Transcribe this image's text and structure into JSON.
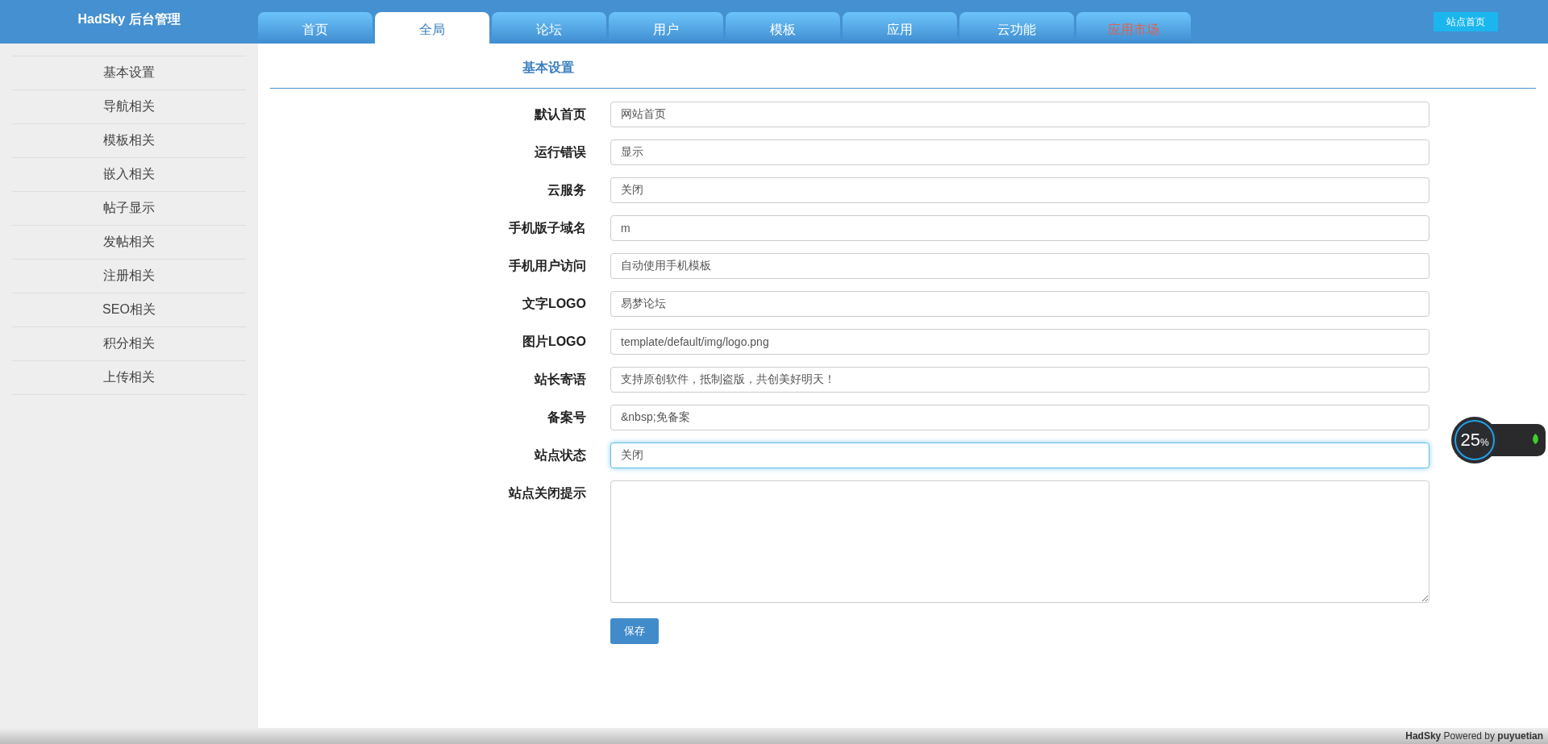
{
  "header": {
    "title": "HadSky 后台管理",
    "site_button": "站点首页"
  },
  "tabs": [
    {
      "label": "首页",
      "selected": false,
      "color": "#ffffff"
    },
    {
      "label": "全局",
      "selected": true,
      "color": "#3a7fc0"
    },
    {
      "label": "论坛",
      "selected": false,
      "color": "#ffffff"
    },
    {
      "label": "用户",
      "selected": false,
      "color": "#ffffff"
    },
    {
      "label": "模板",
      "selected": false,
      "color": "#ffffff"
    },
    {
      "label": "应用",
      "selected": false,
      "color": "#ffffff"
    },
    {
      "label": "云功能",
      "selected": false,
      "color": "#ffffff"
    },
    {
      "label": "应用市场",
      "selected": false,
      "color": "#e0604f"
    }
  ],
  "sidebar": {
    "items": [
      {
        "label": "基本设置"
      },
      {
        "label": "导航相关"
      },
      {
        "label": "模板相关"
      },
      {
        "label": "嵌入相关"
      },
      {
        "label": "帖子显示"
      },
      {
        "label": "发帖相关"
      },
      {
        "label": "注册相关"
      },
      {
        "label": "SEO相关"
      },
      {
        "label": "积分相关"
      },
      {
        "label": "上传相关"
      }
    ]
  },
  "form": {
    "title": "基本设置",
    "fields": [
      {
        "label": "默认首页",
        "kind": "input",
        "value": "网站首页",
        "focused": false
      },
      {
        "label": "运行错误",
        "kind": "input",
        "value": "显示",
        "focused": false
      },
      {
        "label": "云服务",
        "kind": "input",
        "value": "关闭",
        "focused": false
      },
      {
        "label": "手机版子域名",
        "kind": "input",
        "value": "m",
        "focused": false
      },
      {
        "label": "手机用户访问",
        "kind": "input",
        "value": "自动使用手机模板",
        "focused": false
      },
      {
        "label": "文字LOGO",
        "kind": "input",
        "value": "易梦论坛",
        "focused": false
      },
      {
        "label": "图片LOGO",
        "kind": "input",
        "value": "template/default/img/logo.png",
        "focused": false
      },
      {
        "label": "站长寄语",
        "kind": "input",
        "value": "支持原创软件，抵制盗版，共创美好明天！",
        "focused": false
      },
      {
        "label": "备案号",
        "kind": "input",
        "value": "&nbsp;免备案",
        "focused": false
      },
      {
        "label": "站点状态",
        "kind": "input",
        "value": "关闭",
        "focused": true
      },
      {
        "label": "站点关闭提示",
        "kind": "textarea",
        "focused": false
      }
    ],
    "save_button": "保存"
  },
  "widget": {
    "value": "25",
    "unit": "%"
  },
  "footer": {
    "text": "**HadSky** Powered by **puyuetian**"
  }
}
